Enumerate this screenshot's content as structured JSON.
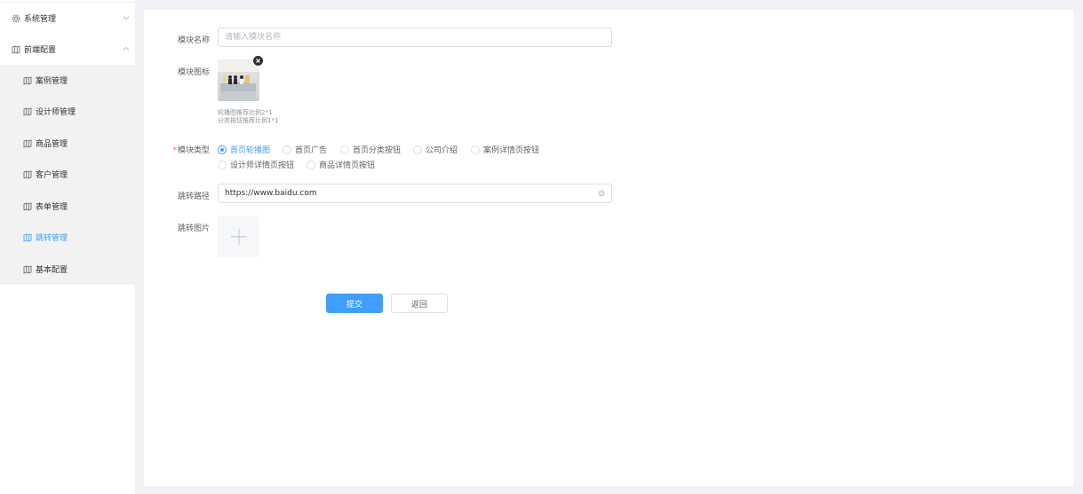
{
  "sidebar": {
    "groups": [
      {
        "label": "系统管理",
        "icon": "gear-icon",
        "expanded": false
      },
      {
        "label": "前端配置",
        "icon": "map-icon",
        "expanded": true
      }
    ],
    "items": [
      {
        "label": "案例管理",
        "icon": "map-icon",
        "active": false
      },
      {
        "label": "设计师管理",
        "icon": "map-icon",
        "active": false
      },
      {
        "label": "商品管理",
        "icon": "map-icon",
        "active": false
      },
      {
        "label": "客户管理",
        "icon": "map-icon",
        "active": false
      },
      {
        "label": "表单管理",
        "icon": "map-icon",
        "active": false
      },
      {
        "label": "跳转管理",
        "icon": "map-icon",
        "active": true
      },
      {
        "label": "基本配置",
        "icon": "map-icon",
        "active": false
      }
    ]
  },
  "form": {
    "module_name": {
      "label": "模块名称",
      "value": "",
      "placeholder": "请输入模块名称"
    },
    "module_icon": {
      "label": "模块图标",
      "hint_line1": "轮播图推荐比例2*1",
      "hint_line2": "分类按钮推荐比例1*1"
    },
    "module_type": {
      "label": "模块类型",
      "required_mark": "*",
      "options": [
        "首页轮播图",
        "首页广告",
        "首页分类按钮",
        "公司介绍",
        "案例详情页按钮",
        "设计师详情页按钮",
        "商品详情页按钮"
      ],
      "selected": "首页轮播图"
    },
    "jump_path": {
      "label": "跳转路径",
      "value": "https://www.baidu.com"
    },
    "jump_image": {
      "label": "跳转图片"
    },
    "submit_label": "提交",
    "back_label": "返回"
  },
  "colors": {
    "accent": "#409eff",
    "active_bg": "#f2f2f2",
    "page_bg": "#f0f2f5"
  }
}
